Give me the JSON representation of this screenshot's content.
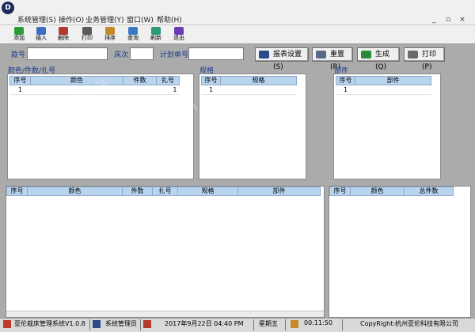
{
  "menubar": {
    "items": [
      "系统管理(S)",
      "操作(O)",
      "业务管理(Y)",
      "窗口(W)",
      "帮助(H)"
    ],
    "window_controls": [
      "_",
      "▫",
      "×"
    ],
    "logo_letter": "D"
  },
  "toolbar": {
    "buttons": [
      {
        "label": "添加",
        "icon": "add-icon",
        "color": "#2d9a3a"
      },
      {
        "label": "插入",
        "icon": "insert-icon",
        "color": "#3a6fc4"
      },
      {
        "label": "删除",
        "icon": "delete-icon",
        "color": "#b23a2a"
      },
      {
        "label": "打印",
        "icon": "print-icon",
        "color": "#5a5a5a"
      },
      {
        "label": "排序",
        "icon": "sort-icon",
        "color": "#c48a2a"
      },
      {
        "label": "查询",
        "icon": "search-icon",
        "color": "#3a7ac4"
      },
      {
        "label": "刷新",
        "icon": "refresh-icon",
        "color": "#2a9a7a"
      },
      {
        "label": "退出",
        "icon": "exit-icon",
        "color": "#6a3ab4"
      }
    ]
  },
  "filter": {
    "style_no_label": "款号",
    "style_no_value": "",
    "bed_no_label": "床次",
    "bed_no_value": "",
    "plan_no_label": "计划单号",
    "plan_no_value": "",
    "report_setup_label": "报表设置(S)",
    "reset_label": "重置(R)",
    "generate_label": "生成(Q)",
    "print_label": "打印(P)"
  },
  "panels": {
    "color": {
      "title": "颜色/件数/扎号",
      "columns": [
        "序号",
        "颜色",
        "件数",
        "扎号"
      ],
      "rows": [
        [
          "1",
          "",
          "",
          "1"
        ]
      ]
    },
    "size": {
      "title": "规格",
      "columns": [
        "序号",
        "规格"
      ],
      "rows": [
        [
          "1",
          ""
        ]
      ]
    },
    "part": {
      "title": "部件",
      "columns": [
        "序号",
        "部件"
      ],
      "rows": [
        [
          "1",
          ""
        ]
      ]
    },
    "detail": {
      "columns": [
        "序号",
        "颜色",
        "件数",
        "扎号",
        "规格",
        "部件"
      ]
    },
    "summary": {
      "columns": [
        "序号",
        "颜色",
        "总件数"
      ]
    }
  },
  "watermark": [
    "多多软件站",
    "www.ddooo.com"
  ],
  "statusbar": {
    "app_name": "亚伦裁床管理系统V1.0.8",
    "user": "系统管理员",
    "date": "2017年9月22日 04:40 PM",
    "weekday": "星期五",
    "timer": "00:11:50",
    "copyright": "CopyRight:杭州亚伦科技有限公司"
  }
}
